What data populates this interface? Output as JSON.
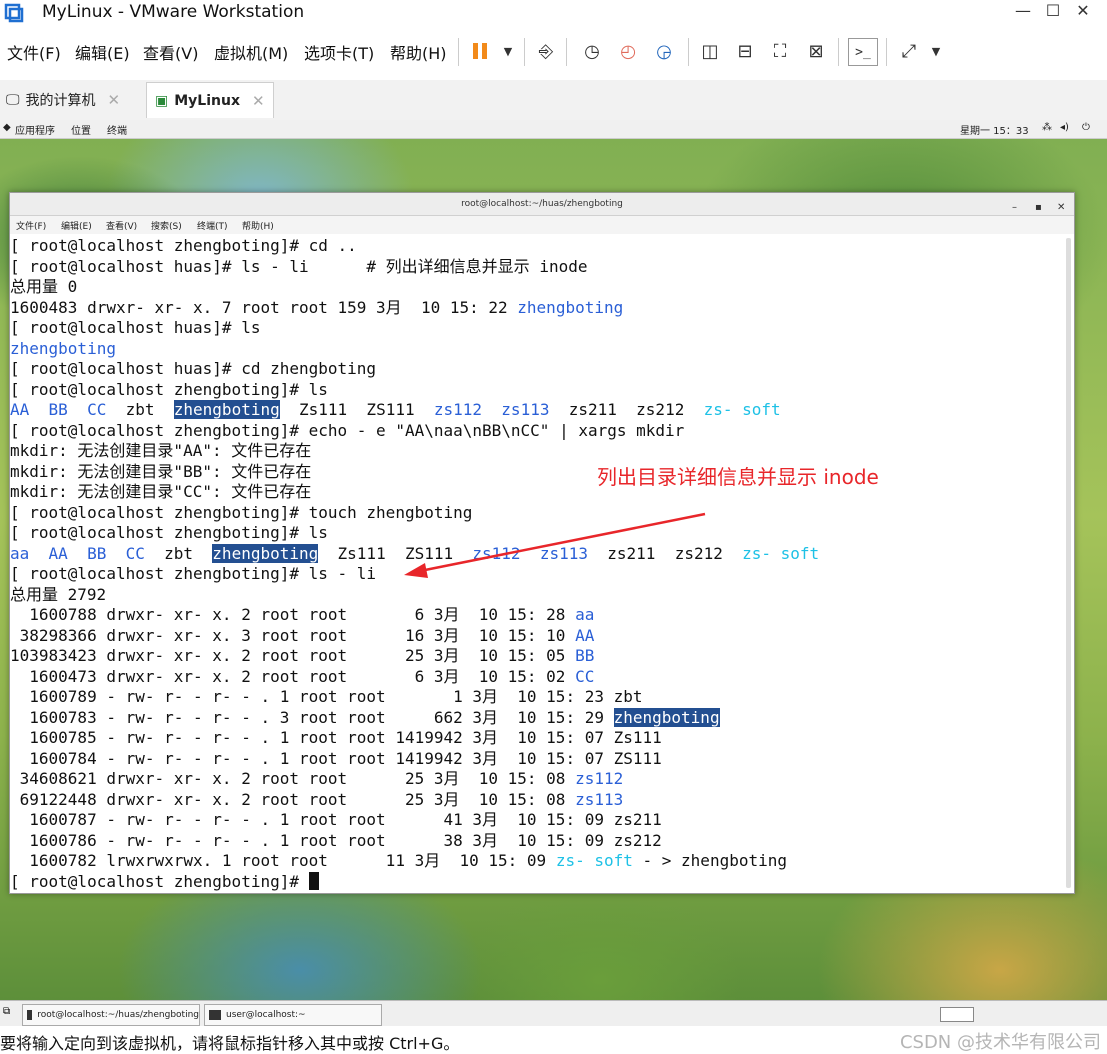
{
  "window": {
    "title": "MyLinux - VMware Workstation"
  },
  "menubar": {
    "items": [
      "文件(F)",
      "编辑(E)",
      "查看(V)",
      "虚拟机(M)",
      "选项卡(T)",
      "帮助(H)"
    ]
  },
  "tabs": [
    {
      "label": "我的计算机"
    },
    {
      "label": "MyLinux"
    }
  ],
  "gnome": {
    "apps": "应用程序",
    "places": "位置",
    "terminal": "终端",
    "clock": "星期一 15：33"
  },
  "terminal": {
    "title": "root@localhost:~/huas/zhengboting",
    "menu": [
      "文件(F)",
      "编辑(E)",
      "查看(V)",
      "搜索(S)",
      "终端(T)",
      "帮助(H)"
    ]
  },
  "annotation": "列出目录详细信息并显示 inode",
  "taskbar": {
    "items": [
      "root@localhost:~/huas/zhengboting",
      "user@localhost:~"
    ]
  },
  "status_text": "要将输入定向到该虚拟机，请将鼠标指针移入其中或按 Ctrl+G。",
  "watermark": "CSDN @技术华有限公司",
  "colors": {
    "dir": "#2a5fd6",
    "symlink": "#1ec1e6",
    "highlight": "#234f91",
    "annotation": "#e8262a"
  },
  "lines": [
    [
      {
        "t": "[ root@localhost zhengboting]# cd .."
      }
    ],
    [
      {
        "t": "[ root@localhost huas]# ls - li      # 列出详细信息并显示 inode"
      }
    ],
    [
      {
        "t": "总用量 0"
      }
    ],
    [
      {
        "t": "1600483 drwxr- xr- x. 7 root root 159 3月  10 15: 22 "
      },
      {
        "t": "zhengboting",
        "c": "dir"
      }
    ],
    [
      {
        "t": "[ root@localhost huas]# ls"
      }
    ],
    [
      {
        "t": "zhengboting",
        "c": "dir"
      }
    ],
    [
      {
        "t": "[ root@localhost huas]# cd zhengboting"
      }
    ],
    [
      {
        "t": "[ root@localhost zhengboting]# ls"
      }
    ],
    [
      {
        "t": "AA",
        "c": "dir"
      },
      {
        "t": "  "
      },
      {
        "t": "BB",
        "c": "dir"
      },
      {
        "t": "  "
      },
      {
        "t": "CC",
        "c": "dir"
      },
      {
        "t": "  zbt  "
      },
      {
        "t": "zhengboting",
        "c": "hl"
      },
      {
        "t": "  Zs111  ZS111  "
      },
      {
        "t": "zs112",
        "c": "dir"
      },
      {
        "t": "  "
      },
      {
        "t": "zs113",
        "c": "dir"
      },
      {
        "t": "  zs211  zs212  "
      },
      {
        "t": "zs- soft",
        "c": "link"
      }
    ],
    [
      {
        "t": "[ root@localhost zhengboting]# echo - e \"AA\\naa\\nBB\\nCC\" | xargs mkdir"
      }
    ],
    [
      {
        "t": "mkdir: 无法创建目录\"AA\": 文件已存在"
      }
    ],
    [
      {
        "t": "mkdir: 无法创建目录\"BB\": 文件已存在"
      }
    ],
    [
      {
        "t": "mkdir: 无法创建目录\"CC\": 文件已存在"
      }
    ],
    [
      {
        "t": "[ root@localhost zhengboting]# touch zhengboting"
      }
    ],
    [
      {
        "t": "[ root@localhost zhengboting]# ls"
      }
    ],
    [
      {
        "t": "aa",
        "c": "dir"
      },
      {
        "t": "  "
      },
      {
        "t": "AA",
        "c": "dir"
      },
      {
        "t": "  "
      },
      {
        "t": "BB",
        "c": "dir"
      },
      {
        "t": "  "
      },
      {
        "t": "CC",
        "c": "dir"
      },
      {
        "t": "  zbt  "
      },
      {
        "t": "zhengboting",
        "c": "hl"
      },
      {
        "t": "  Zs111  ZS111  "
      },
      {
        "t": "zs112",
        "c": "dir"
      },
      {
        "t": "  "
      },
      {
        "t": "zs113",
        "c": "dir"
      },
      {
        "t": "  zs211  zs212  "
      },
      {
        "t": "zs- soft",
        "c": "link"
      }
    ],
    [
      {
        "t": "[ root@localhost zhengboting]# ls - li"
      }
    ],
    [
      {
        "t": "总用量 2792"
      }
    ],
    [
      {
        "t": "  1600788 drwxr- xr- x. 2 root root       6 3月  10 15: 28 "
      },
      {
        "t": "aa",
        "c": "dir"
      }
    ],
    [
      {
        "t": " 38298366 drwxr- xr- x. 3 root root      16 3月  10 15: 10 "
      },
      {
        "t": "AA",
        "c": "dir"
      }
    ],
    [
      {
        "t": "103983423 drwxr- xr- x. 2 root root      25 3月  10 15: 05 "
      },
      {
        "t": "BB",
        "c": "dir"
      }
    ],
    [
      {
        "t": "  1600473 drwxr- xr- x. 2 root root       6 3月  10 15: 02 "
      },
      {
        "t": "CC",
        "c": "dir"
      }
    ],
    [
      {
        "t": "  1600789 - rw- r- - r- - . 1 root root       1 3月  10 15: 23 zbt"
      }
    ],
    [
      {
        "t": "  1600783 - rw- r- - r- - . 3 root root     662 3月  10 15: 29 "
      },
      {
        "t": "zhengboting",
        "c": "hl"
      }
    ],
    [
      {
        "t": "  1600785 - rw- r- - r- - . 1 root root 1419942 3月  10 15: 07 Zs111"
      }
    ],
    [
      {
        "t": "  1600784 - rw- r- - r- - . 1 root root 1419942 3月  10 15: 07 ZS111"
      }
    ],
    [
      {
        "t": " 34608621 drwxr- xr- x. 2 root root      25 3月  10 15: 08 "
      },
      {
        "t": "zs112",
        "c": "dir"
      }
    ],
    [
      {
        "t": " 69122448 drwxr- xr- x. 2 root root      25 3月  10 15: 08 "
      },
      {
        "t": "zs113",
        "c": "dir"
      }
    ],
    [
      {
        "t": "  1600787 - rw- r- - r- - . 1 root root      41 3月  10 15: 09 zs211"
      }
    ],
    [
      {
        "t": "  1600786 - rw- r- - r- - . 1 root root      38 3月  10 15: 09 zs212"
      }
    ],
    [
      {
        "t": "  1600782 lrwxrwxrwx. 1 root root      11 3月  10 15: 09 "
      },
      {
        "t": "zs- soft",
        "c": "link"
      },
      {
        "t": " - > zhengboting"
      }
    ],
    [
      {
        "t": "[ root@localhost zhengboting]# "
      },
      {
        "t": "",
        "c": "cursor"
      }
    ]
  ]
}
